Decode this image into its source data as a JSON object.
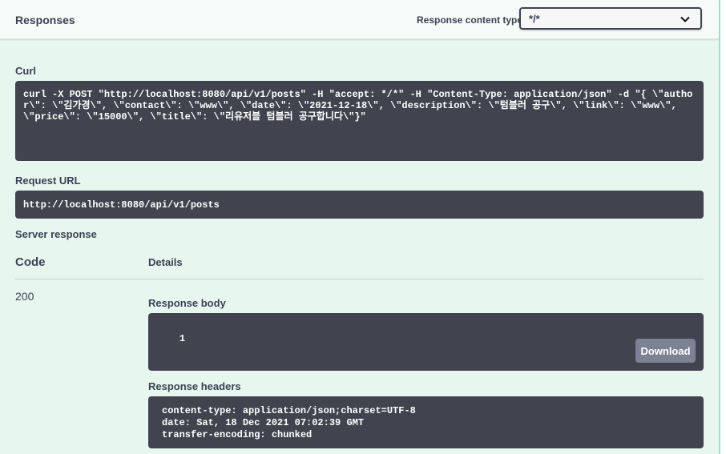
{
  "header": {
    "title": "Responses",
    "content_type_label": "Response content type",
    "content_type_value": "*/*"
  },
  "curl": {
    "label": "Curl",
    "command": "curl -X POST \"http://localhost:8080/api/v1/posts\" -H \"accept: */*\" -H \"Content-Type: application/json\" -d \"{ \\\"author\\\": \\\"김가경\\\", \\\"contact\\\": \\\"www\\\", \\\"date\\\": \\\"2021-12-18\\\", \\\"description\\\": \\\"텀블러 공구\\\", \\\"link\\\": \\\"www\\\", \\\"price\\\": \\\"15000\\\", \\\"title\\\": \\\"리유저블 텀블러 공구합니다\\\"}\""
  },
  "request_url": {
    "label": "Request URL",
    "value": "http://localhost:8080/api/v1/posts"
  },
  "server_response": {
    "label": "Server response",
    "col_code": "Code",
    "col_details": "Details",
    "code": "200",
    "body_label": "Response body",
    "body": "1",
    "download_label": "Download",
    "headers_label": "Response headers",
    "headers": "content-type: application/json;charset=UTF-8\ndate: Sat, 18 Dec 2021 07:02:39 GMT\ntransfer-encoding: chunked"
  }
}
